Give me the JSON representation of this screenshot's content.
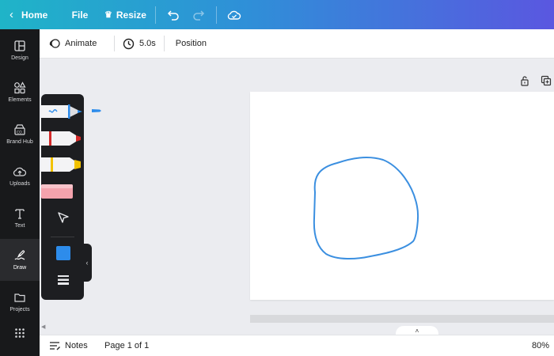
{
  "topbar": {
    "home_label": "Home",
    "file_label": "File",
    "resize_label": "Resize",
    "undo_icon": "undo-icon",
    "redo_icon": "redo-icon",
    "cloud_icon": "cloud-saved-icon",
    "gradient": [
      "#1fb4c8",
      "#2f8fd8",
      "#5a57e0"
    ]
  },
  "sidebar": {
    "items": [
      {
        "label": "Design",
        "icon": "layout-icon"
      },
      {
        "label": "Elements",
        "icon": "shapes-icon"
      },
      {
        "label": "Brand Hub",
        "icon": "brand-icon"
      },
      {
        "label": "Uploads",
        "icon": "upload-cloud-icon"
      },
      {
        "label": "Text",
        "icon": "text-icon"
      },
      {
        "label": "Draw",
        "icon": "draw-icon"
      },
      {
        "label": "Projects",
        "icon": "folder-icon"
      }
    ],
    "active": "Draw"
  },
  "context_toolbar": {
    "animate_label": "Animate",
    "duration_label": "5.0s",
    "position_label": "Position"
  },
  "draw_panel": {
    "tools": [
      "pen",
      "marker",
      "highlighter",
      "eraser",
      "select"
    ],
    "selected_tool": "pen",
    "selected_color": "#2d8ceb"
  },
  "canvas": {
    "stroke_color": "#3b8fe0"
  },
  "bottombar": {
    "notes_label": "Notes",
    "page_label": "Page 1 of 1",
    "zoom_label": "80%"
  }
}
